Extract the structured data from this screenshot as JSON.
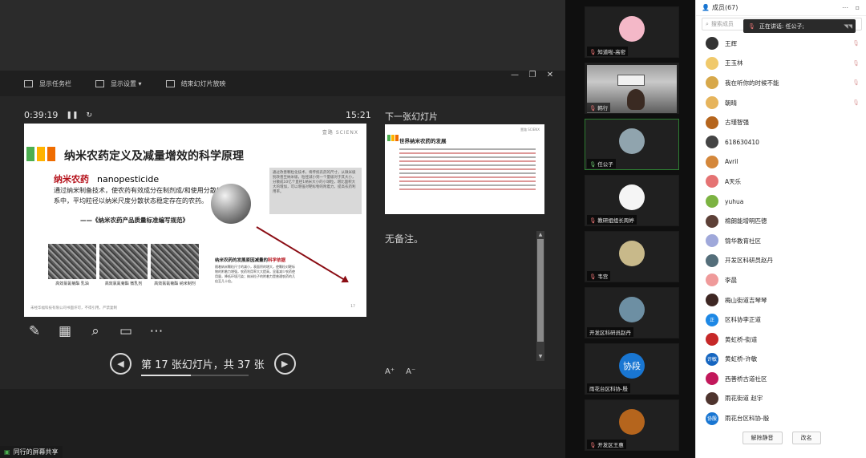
{
  "toolbar": {
    "taskbar": "显示任务栏",
    "display_settings": "显示设置 ▾",
    "end_show": "结束幻灯片放映"
  },
  "presenter": {
    "elapsed": "0:39:19",
    "clock": "15:21",
    "next_slide_label": "下一张幻灯片",
    "notes": "无备注。",
    "nav_text": "第 17 张幻灯片，共 37 张",
    "progress": 0.459
  },
  "slide": {
    "logo": "壹路 SCIENX",
    "title": "纳米农药定义及减量增效的科学原理",
    "term_cn": "纳米农药",
    "term_en": "nanopesticide",
    "definition": "通过纳米制备技术，使农药有效成分在制剂成/和使用分散体系中，平均粒径以纳米尺度分散状态稳定存在的农药。",
    "source": "——《纳米农药产品质量标准编写规范》",
    "side_note": "通过改善颗粒化技术，将传统农药的尺寸，从微米级别改善至纳米级，粒径减小到一个量级对于其大小，分散成10亿个直径1纳米大小的小球粒，增比面积大大的增加，可以增强对靶标物的附着力，提高农药利用率。",
    "micro_images": [
      {
        "caption": "高效氯氰菊酯\n乳油"
      },
      {
        "caption": "高效氯氰菊酯\n微乳剂"
      },
      {
        "caption": "高效氯氰菊酯\n纳米制剂"
      }
    ],
    "sub_head": "纳米农药的发展原因减量的",
    "sub_head_em": "科学依据",
    "sub_lines": "随着纳米颗粒尺寸的减小，表面积的增大，使颗粒对靶标物的附着力增强，农药利用率大大提高，显著减少农药使用量，降低环境污染；纳米粒子的附着力是普通农药的几倍至几十倍。",
    "footer": "未经华福科技有限公司书面许可，不得引用，严禁复制",
    "page": "17",
    "bar_colors": [
      "#4caf50",
      "#ffb300",
      "#ef6c00"
    ]
  },
  "next_slide": {
    "title": "世界纳米农药的发展",
    "logo": "壹路 SCIENX"
  },
  "participants": [
    {
      "name": "知道啦-高密",
      "color": "#f4b8c8"
    },
    {
      "name": "韩行",
      "color": "#888888"
    },
    {
      "name": "任公子",
      "color": "#90a4ae",
      "active": true
    },
    {
      "name": "教研组组长周婷",
      "color": "#f5f5f5"
    },
    {
      "name": "韦宫",
      "color": "#c8b98a"
    },
    {
      "name": "开发区科研员赵丹",
      "color": "#6d8fa3"
    },
    {
      "name": "雨花台区科协-殷",
      "badge": "协段"
    },
    {
      "name": "开发区王惠",
      "color": "#b5651d"
    }
  ],
  "panel": {
    "title": "成员(67)",
    "search_placeholder": "搜索成员",
    "speaking": "正在讲话: 任公子;",
    "buttons": {
      "mute_all": "解除静音",
      "rename": "改名"
    },
    "members": [
      {
        "name": "王辉",
        "color": "#333333"
      },
      {
        "name": "王玉林",
        "color": "#f0c96b"
      },
      {
        "name": "我在听你的时候不能",
        "color": "#d7a84a"
      },
      {
        "name": "朝晴",
        "color": "#e6b45c"
      },
      {
        "name": "古瑾智强",
        "color": "#b5651d"
      },
      {
        "name": "618630410",
        "color": "#444444"
      },
      {
        "name": "Avril",
        "color": "#d4873b"
      },
      {
        "name": "A天乐",
        "color": "#e57373"
      },
      {
        "name": "yuhua",
        "color": "#7cb342"
      },
      {
        "name": "棉朗能增明匹徳",
        "color": "#5d4037"
      },
      {
        "name": "锦华教育社区",
        "color": "#9fa8da"
      },
      {
        "name": "开发区科研员赵丹",
        "color": "#546e7a"
      },
      {
        "name": "李晨",
        "color": "#ef9a9a"
      },
      {
        "name": "梅山街道吉琴琴",
        "color": "#3e2723"
      },
      {
        "name": "区科协李正道",
        "color": "#1e88e5",
        "initials": "正"
      },
      {
        "name": "黄虹桥-街道",
        "color": "#c62828"
      },
      {
        "name": "黄虹桥-许敏",
        "color": "#1565c0",
        "initials": "许敏"
      },
      {
        "name": "西善桥古道社区",
        "color": "#c2185b"
      },
      {
        "name": "雨花街道 赵宇",
        "color": "#4e342e"
      },
      {
        "name": "雨花台区科协-殷",
        "color": "#1976d2",
        "initials": "协殷"
      }
    ]
  },
  "share_tag": "同行的屏幕共享"
}
